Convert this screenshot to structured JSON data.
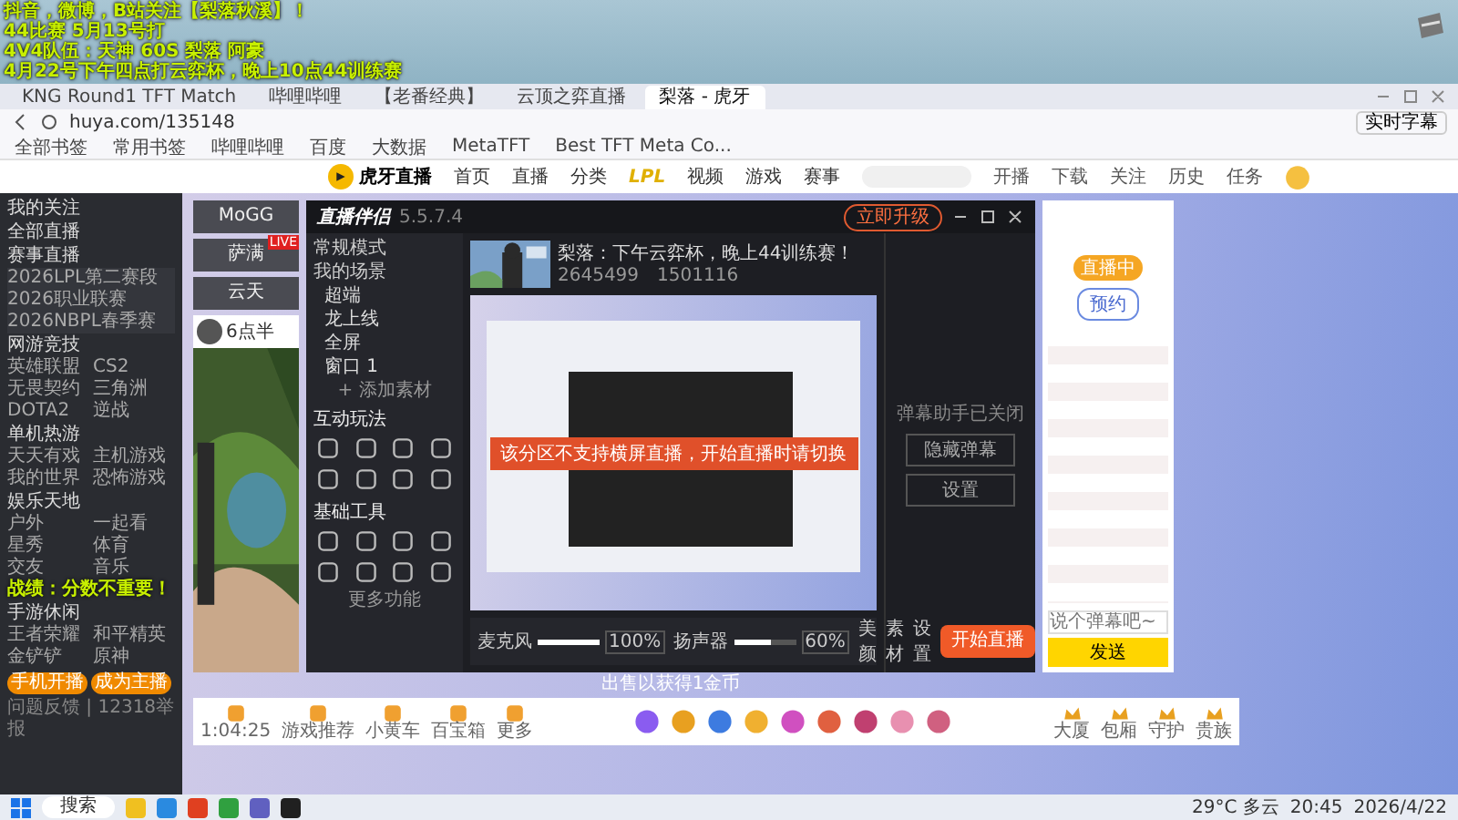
{
  "overlay": {
    "lines": [
      "抖音，微博，B站关注【梨落秋溪】！",
      "44比赛 5月13号打",
      "4V4队伍：天神 60S 梨落 阿豪",
      "4月22号下午四点打云弈杯，晚上10点44训练赛"
    ],
    "bottom_line": "战绩：分数不重要！"
  },
  "browser": {
    "tabs": [
      {
        "title": "KNG Round1 TFT Match",
        "selected": false
      },
      {
        "title": "哔哩哔哩",
        "selected": false
      },
      {
        "title": "【老番经典】",
        "selected": false
      },
      {
        "title": "云顶之弈直播",
        "selected": false
      },
      {
        "title": "梨落 - 虎牙",
        "selected": true
      }
    ],
    "address": "huya.com/135148",
    "bookmarks": [
      "全部书签",
      "常用书签",
      "哔哩哔哩",
      "百度",
      "大数据",
      "MetaTFT",
      "Best TFT Meta Co..."
    ],
    "caption_button": "实时字幕"
  },
  "site": {
    "logo": "虎牙直播",
    "nav": [
      {
        "label": "首页",
        "kind": "text"
      },
      {
        "label": "直播",
        "kind": "text"
      },
      {
        "label": "分类",
        "kind": "text"
      },
      {
        "label": "LPL",
        "kind": "brand"
      },
      {
        "label": "视频",
        "kind": "text"
      },
      {
        "label": "游戏",
        "kind": "text"
      },
      {
        "label": "赛事",
        "kind": "text"
      }
    ],
    "actions": [
      "开播",
      "下载",
      "关注",
      "历史",
      "任务"
    ]
  },
  "sidebar": {
    "links": [
      "我的关注",
      "全部直播"
    ],
    "events_title": "赛事直播",
    "events": [
      "2026LPL第二赛段",
      "2026职业联赛",
      "2026NBPL春季赛"
    ],
    "groups": [
      {
        "title": "网游竞技",
        "items": [
          "英雄联盟",
          "CS2",
          "无畏契约",
          "三角洲",
          "DOTA2",
          "逆战"
        ]
      },
      {
        "title": "单机热游",
        "items": [
          "天天有戏",
          "主机游戏",
          "我的世界",
          "恐怖游戏"
        ]
      },
      {
        "title": "娱乐天地",
        "items": [
          "户外",
          "一起看",
          "星秀",
          "体育",
          "交友",
          "音乐"
        ]
      },
      {
        "title": "手游休闲",
        "items": [
          "王者荣耀",
          "和平精英",
          "金铲铲",
          "原神"
        ]
      }
    ],
    "buttons": [
      "手机开播",
      "成为主播"
    ],
    "footer": "问题反馈 | 12318举报"
  },
  "streamers": [
    {
      "name": "MoGG",
      "live": false
    },
    {
      "name": "萨满",
      "live": true
    },
    {
      "name": "云天",
      "live": false
    }
  ],
  "live_badge": "LIVE",
  "card_name": "6点半",
  "helper": {
    "title": "直播伴侣",
    "version": "5.5.7.4",
    "upgrade": "立即升级",
    "mode": "常规模式",
    "scene_tab": "我的场景",
    "scenes": [
      "超端",
      "龙上线",
      "全屏",
      "窗口 1"
    ],
    "add": "+ 添加素材",
    "sections": [
      "互动玩法",
      "基础工具"
    ],
    "more": "更多功能",
    "stream_title": "梨落：下午云弈杯，晚上44训练赛！",
    "stats": [
      "2645499",
      "1501116"
    ],
    "toast": "该分区不支持横屏直播，开始直播时请切换",
    "mixer": [
      {
        "label": "麦克风",
        "level": 1.0,
        "reading": "100%"
      },
      {
        "label": "扬声器",
        "level": 0.6,
        "reading": "60%"
      }
    ],
    "tools": [
      "美颜",
      "素材",
      "设置"
    ],
    "start": "开始直播",
    "danmaku_note": "弹幕助手已关闭",
    "danmaku_buttons": [
      "隐藏弹幕",
      "设置"
    ]
  },
  "chat": {
    "status": "直播中",
    "follow": "预约",
    "placeholder": "说个弹幕吧~",
    "send": "发送"
  },
  "caption": "出售以获得1金币",
  "giftbar": {
    "left": [
      "1:04:25",
      "游戏推荐",
      "小黄车",
      "百宝箱",
      "更多"
    ],
    "right": [
      "大厦",
      "包厢",
      "守护",
      "贵族"
    ]
  },
  "taskbar": {
    "search": "搜索",
    "weather": "29°C 多云",
    "time": "20:45",
    "date": "2026/4/22"
  }
}
